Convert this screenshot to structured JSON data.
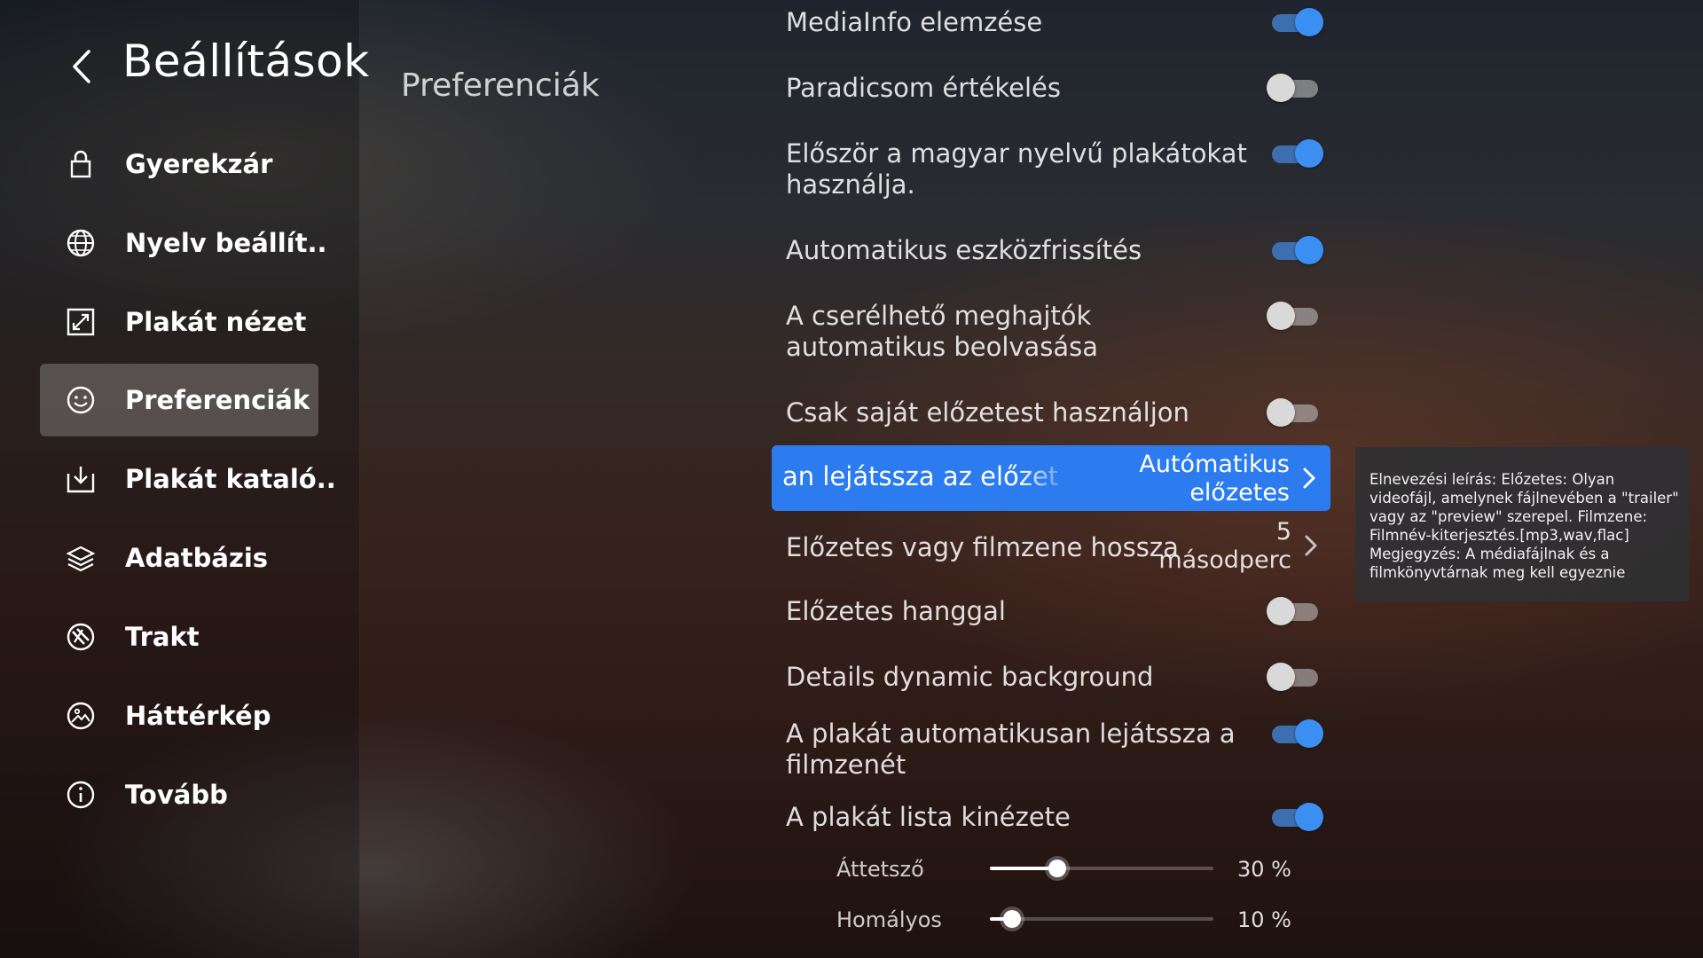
{
  "header": {
    "title": "Beállítások"
  },
  "sidebar": {
    "items": [
      {
        "label": "Gyerekzár",
        "icon": "lock-icon"
      },
      {
        "label": "Nyelv beállít..",
        "icon": "globe-icon"
      },
      {
        "label": "Plakát nézet",
        "icon": "expand-icon"
      },
      {
        "label": "Preferenciák",
        "icon": "smiley-icon",
        "active": true
      },
      {
        "label": "Plakát kataló..",
        "icon": "download-icon"
      },
      {
        "label": "Adatbázis",
        "icon": "database-icon"
      },
      {
        "label": "Trakt",
        "icon": "trakt-icon"
      },
      {
        "label": "Háttérkép",
        "icon": "wallpaper-icon"
      },
      {
        "label": "Tovább",
        "icon": "info-icon"
      }
    ]
  },
  "main": {
    "section_title": "Preferenciák",
    "settings": [
      {
        "label": "MediaInfo elemzése",
        "enabled": true
      },
      {
        "label": "Paradicsom értékelés",
        "enabled": false
      },
      {
        "label": "Először a magyar nyelvű plakátokat használja.",
        "enabled": true
      },
      {
        "label": "Automatikus eszközfrissítés",
        "enabled": true
      },
      {
        "label": "A cserélhető meghajtók automatikus beolvasása",
        "enabled": false
      },
      {
        "label": "Csak saját előzetest használjon",
        "enabled": false
      },
      {
        "label": "Előzetes hanggal",
        "enabled": false
      },
      {
        "label": "Details dynamic background",
        "enabled": false
      },
      {
        "label": "A plakát automatikusan lejátssza a filmzenét",
        "enabled": true
      },
      {
        "label": "A plakát lista kinézete",
        "enabled": true
      }
    ],
    "selected_option": {
      "label_visible": "an lejátssza az előzet",
      "value_line1": "Autómatikus",
      "value_line2": "előzetes"
    },
    "trailer_length": {
      "label": "Előzetes vagy filmzene hossza",
      "value_line1": "5",
      "value_line2": "másodperc"
    },
    "sliders": [
      {
        "label": "Áttetsző",
        "value_text": "30 %",
        "value": 0.3
      },
      {
        "label": "Homályos",
        "value_text": "10 %",
        "value": 0.1
      }
    ]
  },
  "tooltip": {
    "text": "Elnevezési leírás: Előzetes: Olyan videofájl, amelynek fájlnevében a \"trailer\" vagy az \"preview\" szerepel. Filmzene: Filmnév-kiterjesztés.[mp3,wav,flac] Megjegyzés: A médiafájlnak és a filmkönyvtárnak meg kell egyeznie"
  },
  "colors": {
    "accent": "#2c7cf0",
    "toggle_on": "#3b8ff3"
  }
}
